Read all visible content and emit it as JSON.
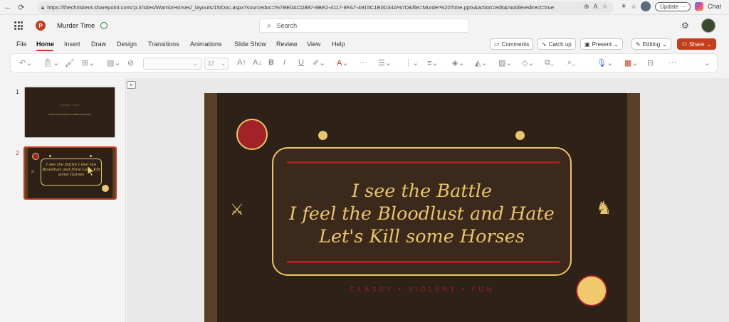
{
  "browser": {
    "url": "https://thechriskent.sharepoint.com/:p:/r/sites/WarriorHorses/_layouts/15/Doc.aspx?sourcedoc=%7BE0ACD887-8BE2-4117-8FA7-4915C1B0D34A%7D&file=Murder%20Time.pptx&action=edit&mobileredirect=true",
    "update_label": "Update",
    "chat_label": "Chat"
  },
  "app": {
    "doc_title": "Murder Time",
    "search_placeholder": "Search"
  },
  "menu": {
    "tabs": [
      "File",
      "Home",
      "Insert",
      "Draw",
      "Design",
      "Transitions",
      "Animations",
      "Slide Show",
      "Review",
      "View",
      "Help"
    ],
    "comments_label": "Comments",
    "catchup_label": "Catch up",
    "present_label": "Present",
    "editing_label": "Editing",
    "share_label": "Share"
  },
  "ribbon": {
    "font_size": "12"
  },
  "thumbnails": [
    {
      "number": "1",
      "title": "Murder Time",
      "subtitle": "a story that we hope is considered cautionary"
    },
    {
      "number": "2",
      "text": "I see the Battle I feel the Bloodlust and Hate Let's Kill some Horses"
    }
  ],
  "slide": {
    "lines": [
      "I see the Battle",
      "I feel the Bloodlust and Hate",
      "Let's Kill some Horses"
    ],
    "tagline": "CLASSY • VIOLENT • FUN",
    "colors": {
      "background": "#2e2117",
      "gold": "#e9c46a",
      "red": "#a32228",
      "brown_stripe": "#5a3f27"
    },
    "icons": {
      "left": "crossed-swords-icon",
      "right": "chess-knight-icon"
    }
  }
}
